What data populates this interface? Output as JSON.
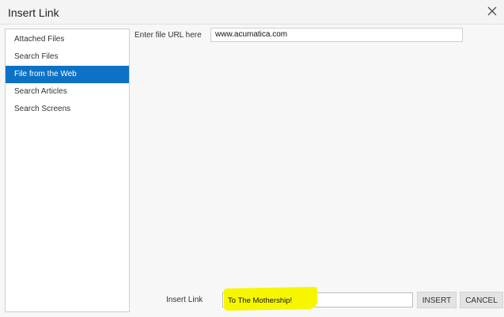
{
  "dialog": {
    "title": "Insert Link"
  },
  "sidebar": {
    "items": [
      {
        "label": "Attached Files"
      },
      {
        "label": "Search Files"
      },
      {
        "label": "File from the Web"
      },
      {
        "label": "Search Articles"
      },
      {
        "label": "Search Screens"
      }
    ],
    "active_index": 2
  },
  "url_field": {
    "label": "Enter file URL here",
    "value": "www.acumatica.com"
  },
  "link_field": {
    "label": "Insert Link",
    "value": "To The Mothership!",
    "highlight_color": "#f6f600"
  },
  "buttons": {
    "insert": "INSERT",
    "cancel": "CANCEL"
  },
  "colors": {
    "accent": "#0d72c5"
  },
  "icons": {
    "close": "close-icon"
  }
}
